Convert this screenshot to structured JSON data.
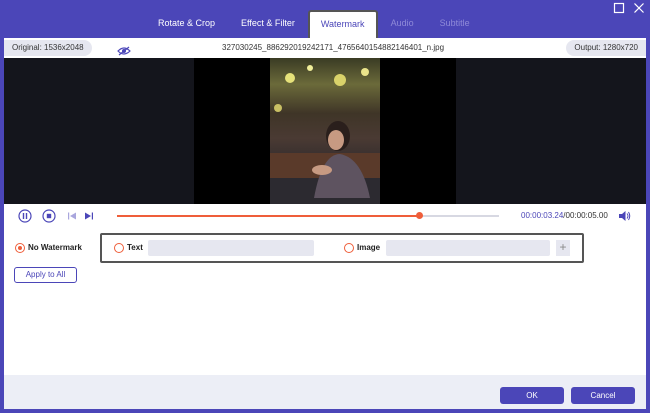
{
  "tabs": [
    {
      "label": "Rotate & Crop",
      "state": "normal"
    },
    {
      "label": "Effect & Filter",
      "state": "normal"
    },
    {
      "label": "Watermark",
      "state": "active"
    },
    {
      "label": "Audio",
      "state": "disabled"
    },
    {
      "label": "Subtitle",
      "state": "disabled"
    }
  ],
  "window": {
    "maximize_icon": "maximize-icon",
    "close_icon": "close-icon"
  },
  "info": {
    "original": "Original: 1536x2048",
    "filename": "327030245_886292019242171_4765640154882146401_n.jpg",
    "output": "Output: 1280x720"
  },
  "playback": {
    "current_time": "00:00:03.24",
    "separator": "/",
    "total_time": "00:00:05.00",
    "progress": 0.79
  },
  "watermark": {
    "options": [
      {
        "label": "No Watermark",
        "selected": true
      },
      {
        "label": "Text",
        "selected": false
      },
      {
        "label": "Image",
        "selected": false
      }
    ],
    "text_value": "",
    "image_value": "",
    "add_label": "+",
    "apply_all": "Apply to All"
  },
  "footer": {
    "ok": "OK",
    "cancel": "Cancel"
  },
  "colors": {
    "accent": "#4b46b8",
    "highlight": "#ef5e3a"
  }
}
